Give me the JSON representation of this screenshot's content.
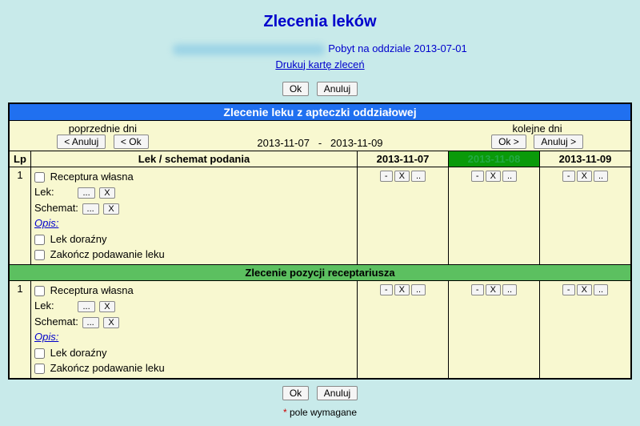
{
  "title": "Zlecenia leków",
  "stay_label": "Pobyt na oddziale 2013-07-01",
  "print_link": "Drukuj kartę zleceń",
  "buttons": {
    "ok": "Ok",
    "cancel": "Anuluj",
    "prev_cancel": "< Anuluj",
    "prev_ok": "< Ok",
    "next_ok": "Ok >",
    "next_cancel": "Anuluj >",
    "dots": "...",
    "x": "X",
    "minus": "-",
    "dotdot": ".."
  },
  "section1": "Zlecenie leku z apteczki oddziałowej",
  "section2": "Zlecenie pozycji receptariusza",
  "nav": {
    "prev_label": "poprzednie dni",
    "next_label": "kolejne dni",
    "date_from": "2013-11-07",
    "date_sep": "-",
    "date_to": "2013-11-09"
  },
  "cols": {
    "lp": "Lp",
    "med": "Lek / schemat podania",
    "d1": "2013-11-07",
    "d2": "2013-11-08",
    "d3": "2013-11-09"
  },
  "row": {
    "lp": "1",
    "own": "Receptura własna",
    "lek": "Lek:",
    "schemat": "Schemat:",
    "opis": "Opis:",
    "emergency": "Lek doraźny",
    "finish": "Zakończ podawanie leku"
  },
  "footer": {
    "required": "pole wymagane",
    "star": "*"
  }
}
